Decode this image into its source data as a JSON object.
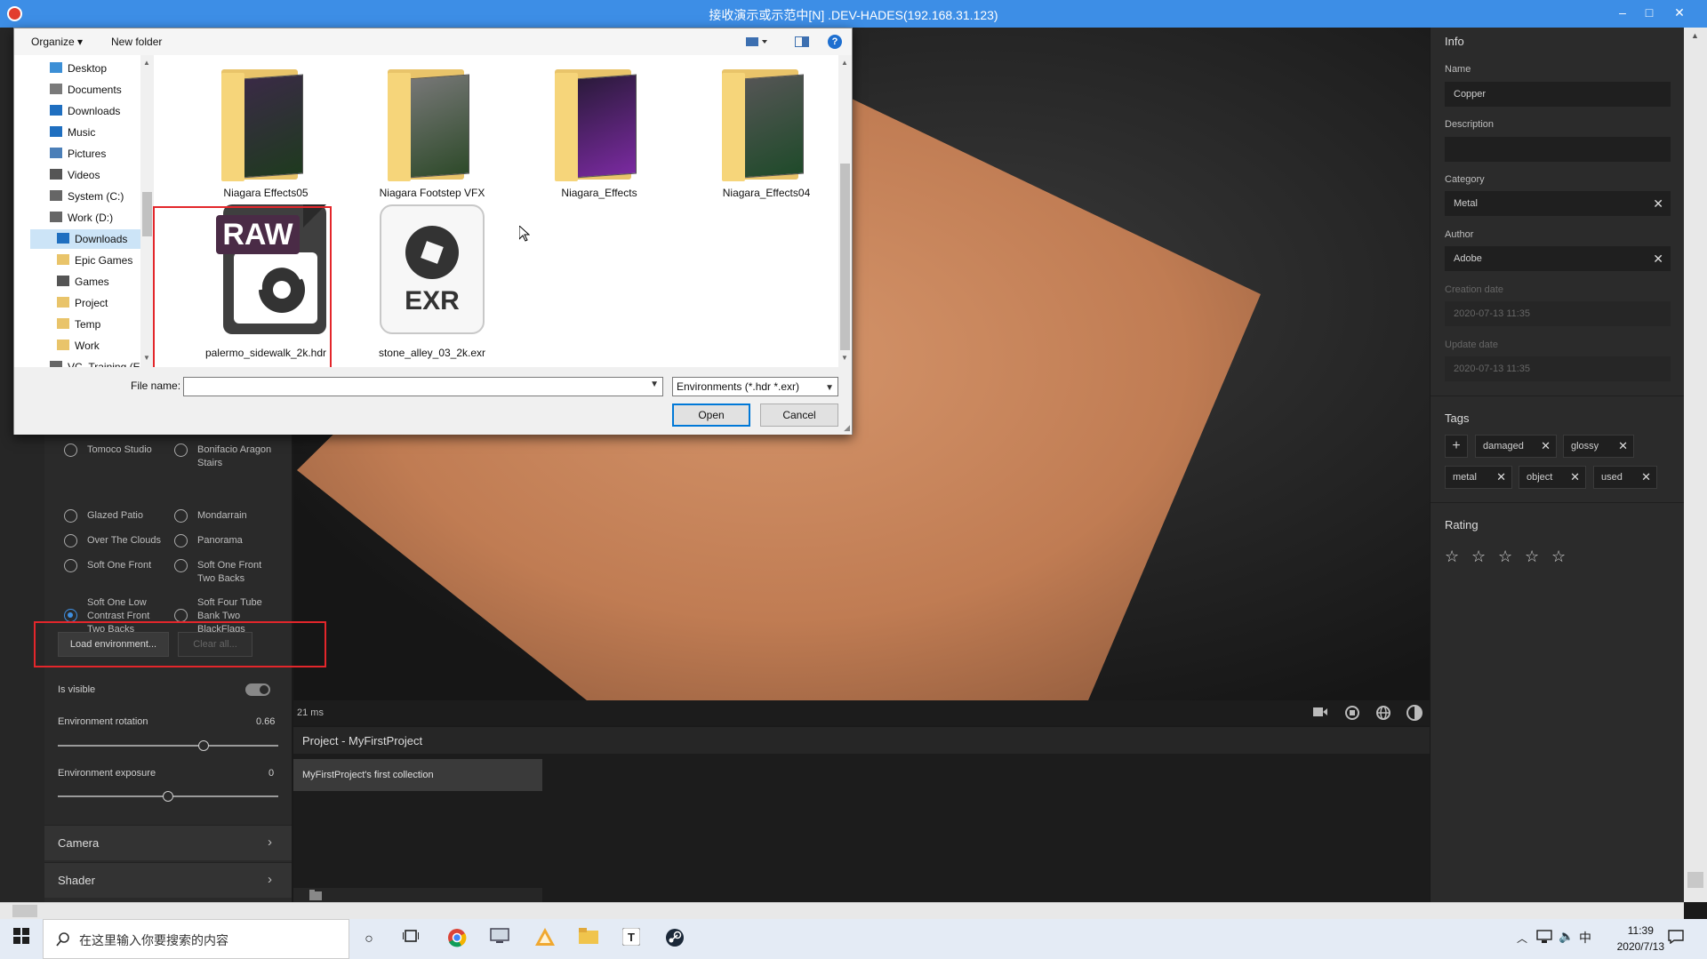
{
  "window": {
    "title": "接收演示或示范中[N] .DEV-HADES(192.168.31.123)",
    "minimize": "–",
    "maximize": "□",
    "close": "✕"
  },
  "dialog": {
    "toolbar": {
      "organize": "Organize ▾",
      "new_folder": "New folder"
    },
    "nav_items": [
      {
        "label": "Desktop",
        "icon": "desktop-icon",
        "color": "#3c8fd6"
      },
      {
        "label": "Documents",
        "icon": "documents-icon",
        "color": "#7a7a7a"
      },
      {
        "label": "Downloads",
        "icon": "download-icon",
        "color": "#1f6fc0"
      },
      {
        "label": "Music",
        "icon": "music-icon",
        "color": "#1f6fc0"
      },
      {
        "label": "Pictures",
        "icon": "pictures-icon",
        "color": "#4b7fb8"
      },
      {
        "label": "Videos",
        "icon": "videos-icon",
        "color": "#555"
      },
      {
        "label": "System (C:)",
        "icon": "drive-icon",
        "color": "#666"
      },
      {
        "label": "Work (D:)",
        "icon": "drive-icon",
        "color": "#666"
      },
      {
        "label": "Downloads",
        "icon": "download-icon",
        "color": "#1f6fc0"
      },
      {
        "label": "Epic Games",
        "icon": "folder-icon",
        "color": "#e9c46a"
      },
      {
        "label": "Games",
        "icon": "folder-icon",
        "color": "#555"
      },
      {
        "label": "Project",
        "icon": "folder-icon",
        "color": "#e9c46a"
      },
      {
        "label": "Temp",
        "icon": "folder-icon",
        "color": "#e9c46a"
      },
      {
        "label": "Work",
        "icon": "folder-icon",
        "color": "#e9c46a"
      },
      {
        "label": "VC_Training (E:",
        "icon": "drive-icon",
        "color": "#666"
      }
    ],
    "files": [
      {
        "name": "Niagara Effects05",
        "type": "folder"
      },
      {
        "name": "Niagara Footstep VFX",
        "type": "folder"
      },
      {
        "name": "Niagara_Effects",
        "type": "folder"
      },
      {
        "name": "Niagara_Effects04",
        "type": "folder"
      },
      {
        "name": "palermo_sidewalk_2k.hdr",
        "type": "raw",
        "badge": "RAW"
      },
      {
        "name": "stone_alley_03_2k.exr",
        "type": "exr",
        "badge": "EXR"
      }
    ],
    "file_name_label": "File name:",
    "file_name_value": "",
    "file_type": "Environments (*.hdr *.exr)",
    "open_label": "Open",
    "cancel_label": "Cancel"
  },
  "left_panel": {
    "environments": [
      {
        "label": "Tomoco Studio",
        "checked": false
      },
      {
        "label": "Bonifacio Aragon Stairs",
        "checked": false
      },
      {
        "label": "Glazed Patio",
        "checked": false
      },
      {
        "label": "Mondarrain",
        "checked": false
      },
      {
        "label": "Over The Clouds",
        "checked": false
      },
      {
        "label": "Panorama",
        "checked": false
      },
      {
        "label": "Soft One Front",
        "checked": false
      },
      {
        "label": "Soft One Front Two Backs",
        "checked": false
      },
      {
        "label": "Soft One Low Contrast Front Two Backs",
        "checked": true
      },
      {
        "label": "Soft Four Tube Bank Two BlackFlags",
        "checked": false
      }
    ],
    "load_env_label": "Load environment...",
    "clear_all_label": "Clear all...",
    "is_visible_label": "Is visible",
    "is_visible": true,
    "env_rotation_label": "Environment rotation",
    "env_rotation_value": "0.66",
    "env_rotation_fraction": 0.66,
    "env_exposure_label": "Environment exposure",
    "env_exposure_value": "0",
    "env_exposure_fraction": 0.5,
    "camera_label": "Camera",
    "shader_label": "Shader"
  },
  "viewport": {
    "frame_time": "21 ms"
  },
  "project": {
    "title": "Project - MyFirstProject",
    "collection": "MyFirstProject's first collection"
  },
  "info_panel": {
    "title": "Info",
    "name_label": "Name",
    "name_value": "Copper",
    "description_label": "Description",
    "description_value": "",
    "category_label": "Category",
    "category_value": "Metal",
    "author_label": "Author",
    "author_value": "Adobe",
    "creation_label": "Creation date",
    "creation_value": "2020-07-13 11:35",
    "update_label": "Update date",
    "update_value": "2020-07-13 11:35",
    "tags_title": "Tags",
    "tags": [
      "damaged",
      "glossy",
      "metal",
      "object",
      "used"
    ],
    "rating_title": "Rating",
    "rating": 0,
    "rating_max": 5
  },
  "taskbar": {
    "search_placeholder": "在这里输入你要搜索的内容",
    "time": "11:39",
    "date": "2020/7/13",
    "ime": "中"
  },
  "colors": {
    "accent": "#3d8ee6",
    "highlight_red": "#e3262b",
    "copper": "#c9875e"
  }
}
